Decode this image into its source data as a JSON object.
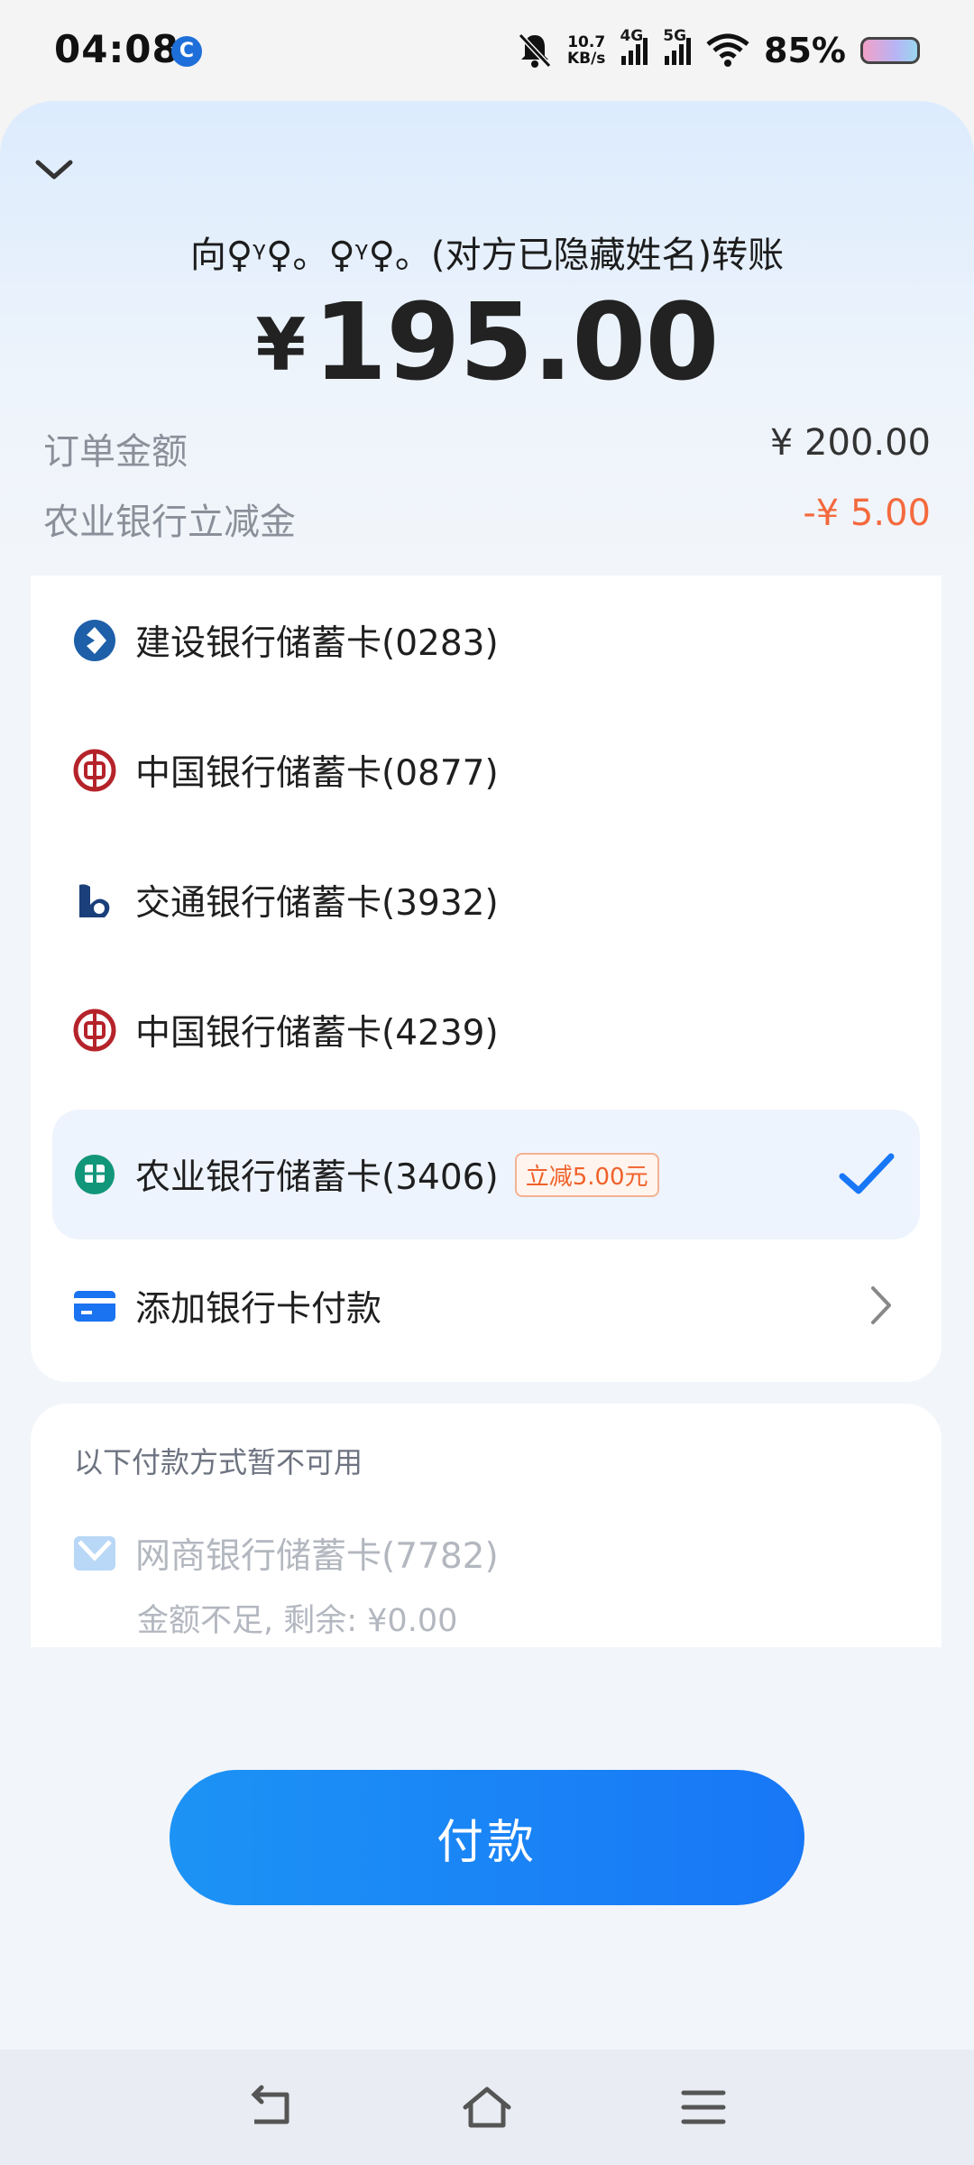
{
  "status_bar": {
    "time": "04:08",
    "net_speed_value": "10.7",
    "net_speed_unit": "KB/s",
    "signal_1": "4G",
    "signal_2": "5G",
    "battery": "85%"
  },
  "payment": {
    "payee_text": "向♀ᵞ♀。♀ᵞ♀。(对方已隐藏姓名)转账",
    "currency_symbol": "¥",
    "amount": "195.00",
    "order_label": "订单金额",
    "order_value": "¥ 200.00",
    "discount_label": "农业银行立减金",
    "discount_value": "-¥ 5.00"
  },
  "cards": [
    {
      "label": "建设银行储蓄卡(0283)",
      "icon": "ccb-bank-icon",
      "color": "#1d5fa8"
    },
    {
      "label": "中国银行储蓄卡(0877)",
      "icon": "boc-bank-icon",
      "color": "#b5232a"
    },
    {
      "label": "交通银行储蓄卡(3932)",
      "icon": "bocom-bank-icon",
      "color": "#1b3f7a"
    },
    {
      "label": "中国银行储蓄卡(4239)",
      "icon": "boc-bank-icon",
      "color": "#b5232a"
    },
    {
      "label": "农业银行储蓄卡(3406)",
      "icon": "abc-bank-icon",
      "color": "#12967a",
      "promo": "立减5.00元",
      "selected": true
    }
  ],
  "add_card": {
    "label": "添加银行卡付款",
    "icon": "card-icon"
  },
  "unavailable": {
    "title": "以下付款方式暂不可用",
    "card_label": "网商银行储蓄卡(7782)",
    "card_sub": "金额不足, 剩余: ¥0.00"
  },
  "pay_button": "付款",
  "colors": {
    "accent": "#1877f6",
    "discount": "#f46a3e"
  }
}
